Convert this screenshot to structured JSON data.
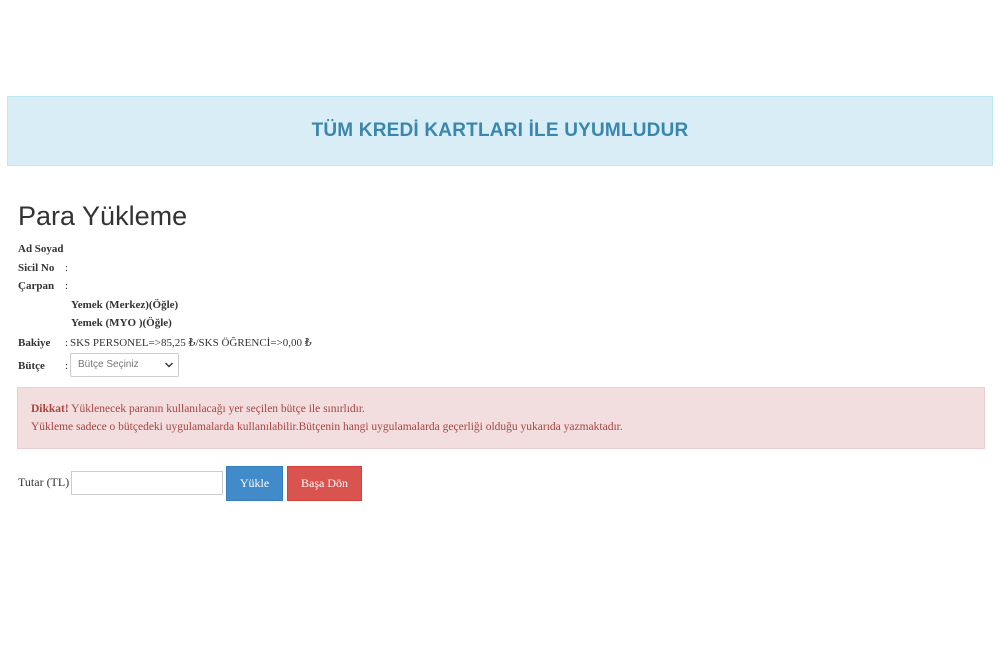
{
  "banner": {
    "text": "TÜM KREDİ KARTLARI İLE UYUMLUDUR",
    "background": "#d9edf7",
    "text_color": "#3a87ad"
  },
  "page": {
    "title": "Para Yükleme"
  },
  "info": {
    "separator": ":",
    "name_label": "Ad Soyad",
    "name_value": "",
    "registry_label": "Sicil No",
    "registry_value": "",
    "multiplier_label": "Çarpan",
    "multiplier_value": "",
    "multiplier_items": [
      "Yemek (Merkez)(Öğle)",
      "Yemek (MYO )(Öğle)"
    ],
    "balance_label": "Bakiye",
    "balance_value": "SKS PERSONEL=>85,25 ₺/SKS ÖĞRENCİ=>0,00 ₺",
    "budget_label": "Bütçe"
  },
  "budget_select": {
    "selected": "Bütçe Seçiniz",
    "icon": "chevron-down-icon"
  },
  "alert": {
    "strong": "Dikkat!",
    "line1": "Yüklenecek paranın kullanılacağı yer seçilen bütçe ile sınırlıdır.",
    "line2": "Yükleme sadece o bütçedeki uygulamalarda kullanılabilir.Bütçenin hangi uygulamalarda geçerliği olduğu yukarıda yazmaktadır.",
    "background": "#f2dede",
    "text_color": "#a94442"
  },
  "form": {
    "amount_label": "Tutar (TL)",
    "amount_value": "",
    "upload_button": "Yükle",
    "back_button": "Başa Dön",
    "upload_color": "#428bca",
    "back_color": "#d9534f"
  }
}
